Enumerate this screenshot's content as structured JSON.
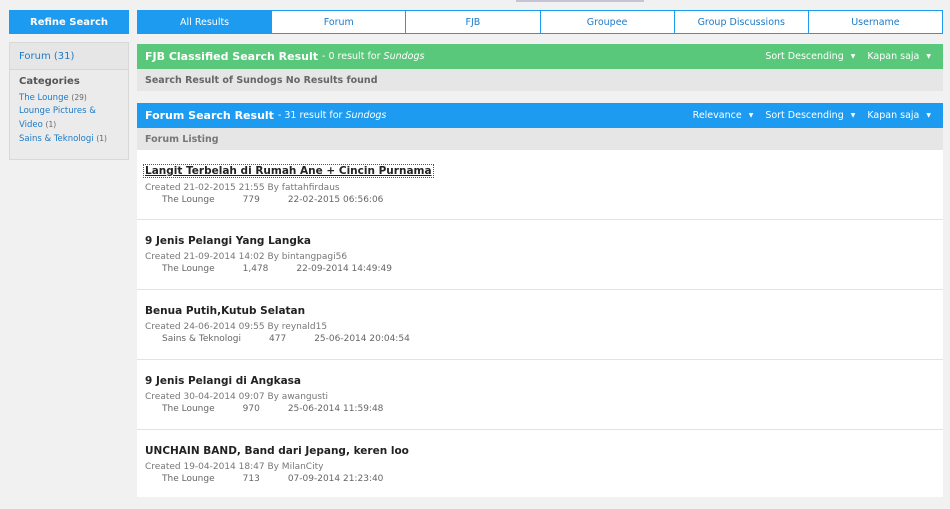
{
  "sidebar": {
    "refine_label": "Refine Search",
    "forum_count": "Forum (31)",
    "categories_title": "Categories",
    "categories": [
      {
        "name": "The Lounge",
        "count": "(29)"
      },
      {
        "name": "Lounge Pictures & Video",
        "count": "(1)"
      },
      {
        "name": "Sains & Teknologi",
        "count": "(1)"
      }
    ]
  },
  "tabs": [
    "All Results",
    "Forum",
    "FJB",
    "Groupee",
    "Group Discussions",
    "Username"
  ],
  "fjb": {
    "title": "FJB Classified Search Result",
    "subtitle_prefix": "- 0 result for",
    "query": "Sundogs",
    "sort_label": "Sort Descending",
    "time_label": "Kapan saja",
    "no_result": "Search Result of Sundogs No Results found"
  },
  "forum": {
    "title": "Forum Search Result",
    "subtitle_prefix": "- 31 result for",
    "query": "Sundogs",
    "relevance_label": "Relevance",
    "sort_label": "Sort Descending",
    "time_label": "Kapan saja",
    "listing_label": "Forum Listing",
    "results": [
      {
        "title": "Langit Terbelah di Rumah Ane + Cincin Purnama",
        "created": "Created 21-02-2015 21:55 By fattahfirdaus",
        "category": "The Lounge",
        "views": "779",
        "last": "22-02-2015 06:56:06"
      },
      {
        "title": "9 Jenis Pelangi Yang Langka",
        "created": "Created 21-09-2014 14:02 By bintangpagi56",
        "category": "The Lounge",
        "views": "1,478",
        "last": "22-09-2014 14:49:49"
      },
      {
        "title": "Benua Putih,Kutub Selatan",
        "created": "Created 24-06-2014 09:55 By reynald15",
        "category": "Sains & Teknologi",
        "views": "477",
        "last": "25-06-2014 20:04:54"
      },
      {
        "title": "9 Jenis Pelangi di Angkasa",
        "created": "Created 30-04-2014 09:07 By awangusti",
        "category": "The Lounge",
        "views": "970",
        "last": "25-06-2014 11:59:48"
      },
      {
        "title": "UNCHAIN BAND, Band dari Jepang, keren loo",
        "created": "Created 19-04-2014 18:47 By MilanCity",
        "category": "The Lounge",
        "views": "713",
        "last": "07-09-2014 21:23:40"
      }
    ]
  },
  "colors": {
    "accent": "#1d9bf0",
    "fjb_green": "#5ac87a"
  }
}
